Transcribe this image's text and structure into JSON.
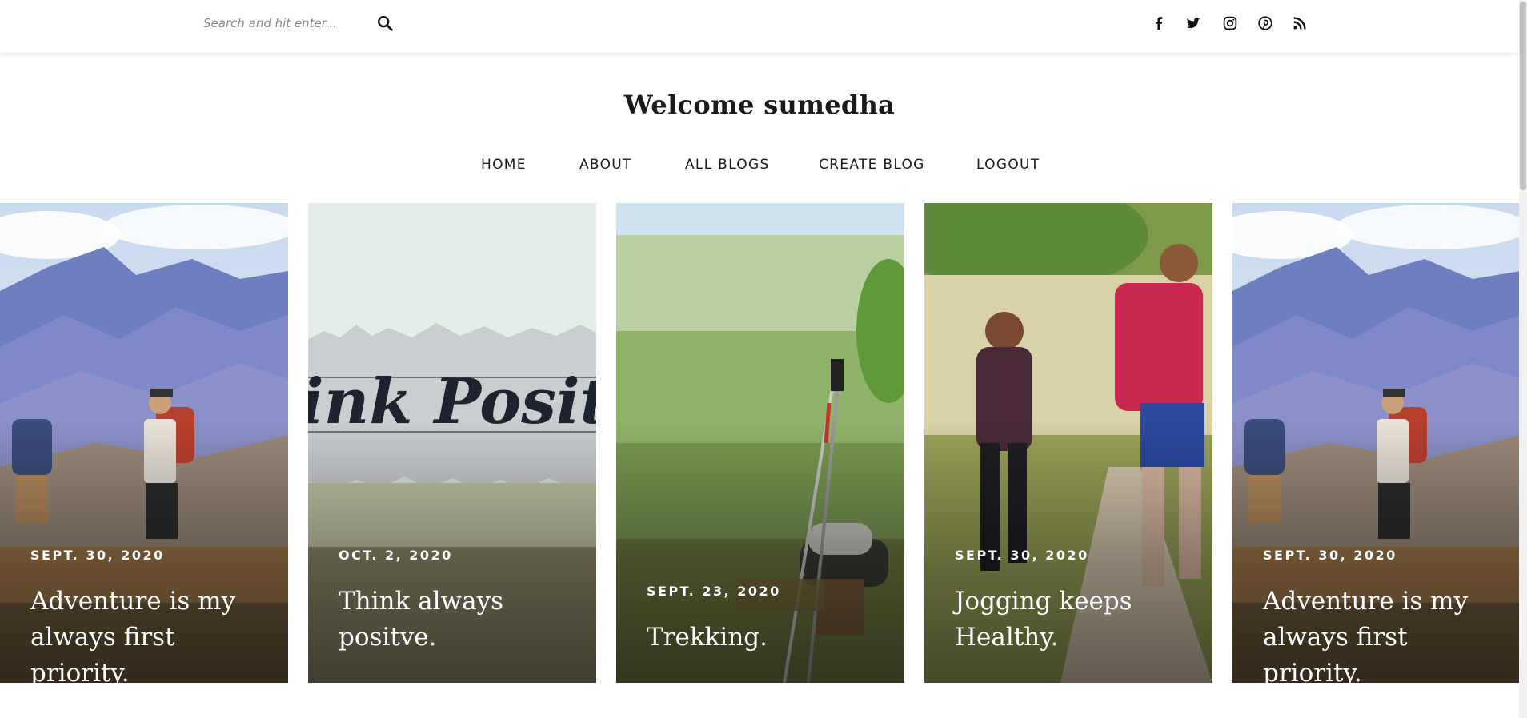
{
  "search": {
    "placeholder": "Search and hit enter..."
  },
  "social": [
    {
      "icon": "facebook-icon"
    },
    {
      "icon": "twitter-icon"
    },
    {
      "icon": "instagram-icon"
    },
    {
      "icon": "pinterest-icon"
    },
    {
      "icon": "rss-icon"
    }
  ],
  "site": {
    "title": "Welcome sumedha"
  },
  "nav": {
    "home": "HOME",
    "about": "ABOUT",
    "all_blogs": "ALL BLOGS",
    "create_blog": "CREATE BLOG",
    "logout": "LOGOUT"
  },
  "posts": [
    {
      "date": "SEPT. 30, 2020",
      "title": "Adventure is my always first priority."
    },
    {
      "date": "OCT. 2, 2020",
      "title": "Think always positve."
    },
    {
      "date": "SEPT. 23, 2020",
      "title": "Trekking."
    },
    {
      "date": "SEPT. 30, 2020",
      "title": "Jogging keeps Healthy."
    },
    {
      "date": "SEPT. 30, 2020",
      "title": "Adventure is my always first priority."
    }
  ],
  "colors": {
    "text": "#1a1a1a",
    "overlay_text": "#ffffff"
  }
}
